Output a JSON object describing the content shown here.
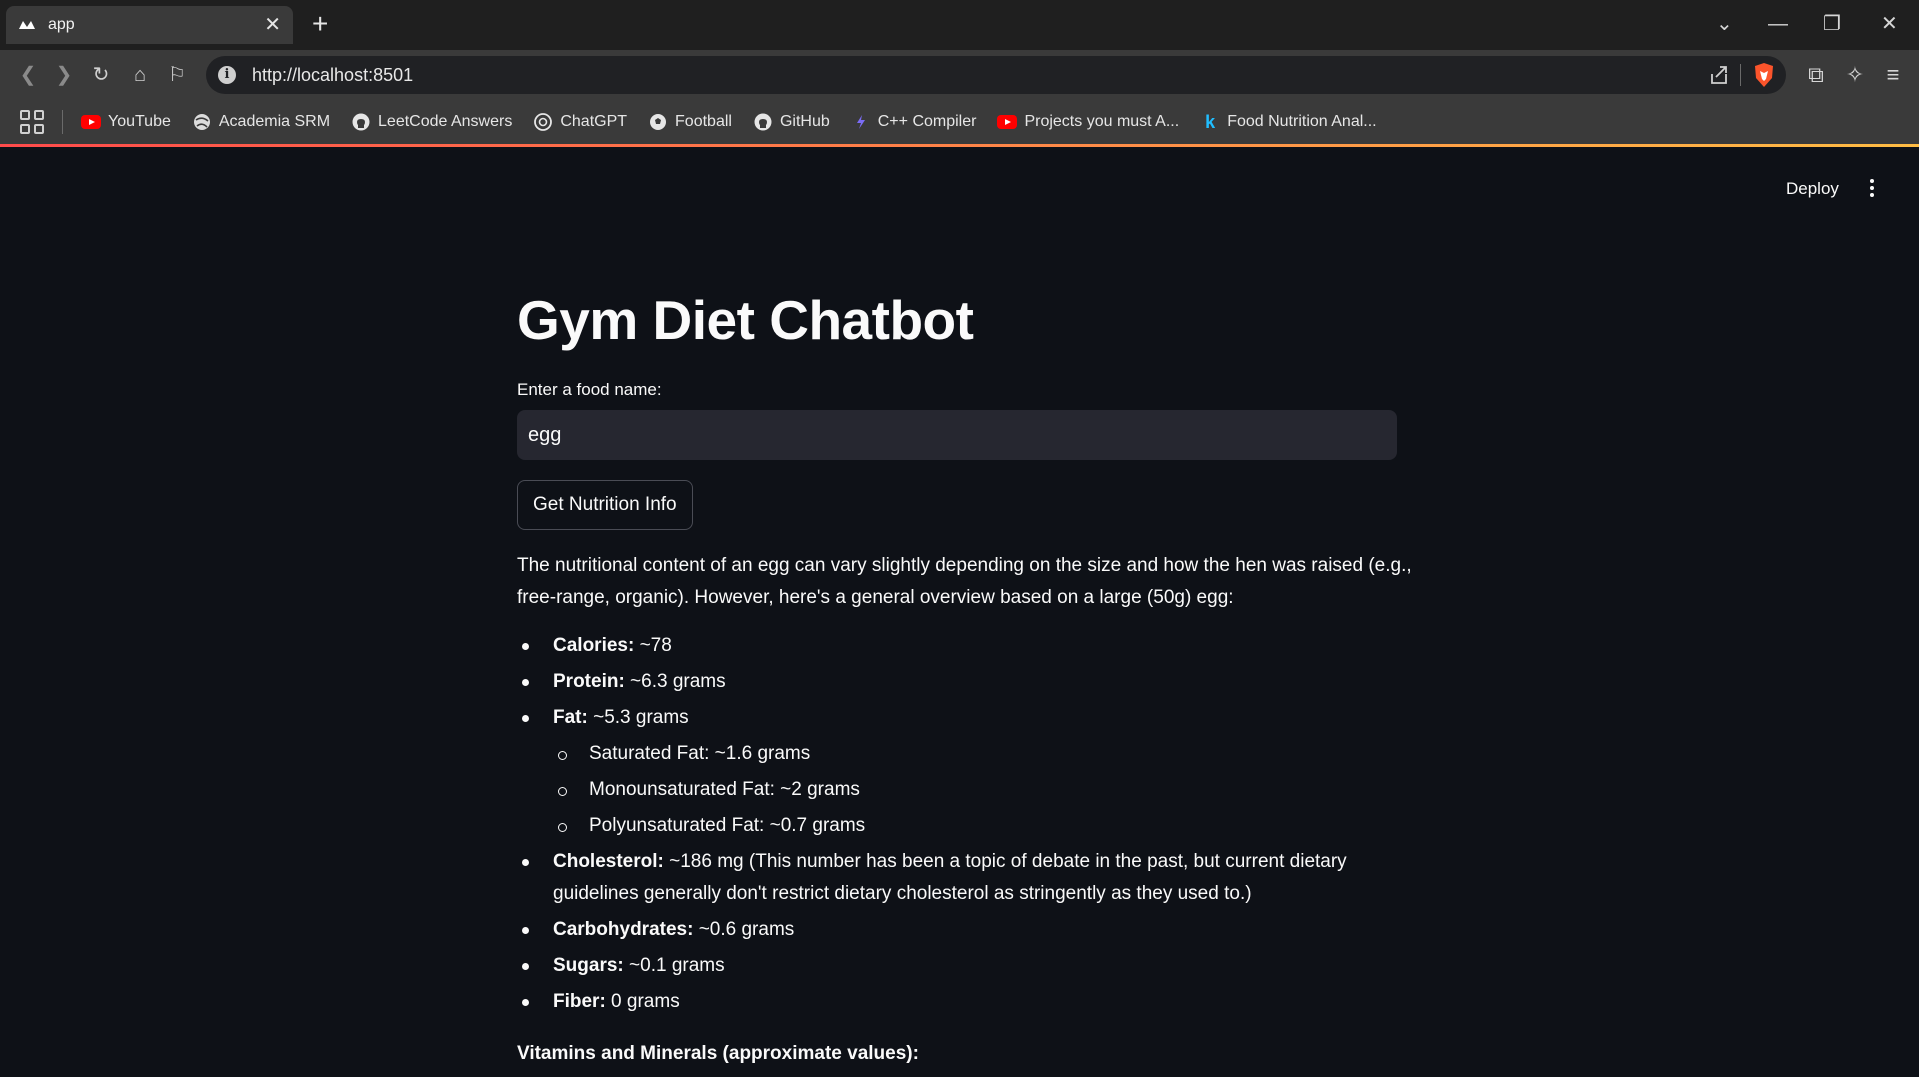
{
  "browser": {
    "tab_title": "app",
    "url": "http://localhost:8501",
    "bookmarks": [
      {
        "label": "YouTube",
        "icon": "youtube-icon"
      },
      {
        "label": "Academia SRM",
        "icon": "globe-icon"
      },
      {
        "label": "LeetCode Answers",
        "icon": "github-icon"
      },
      {
        "label": "ChatGPT",
        "icon": "openai-icon"
      },
      {
        "label": "Football",
        "icon": "football-icon"
      },
      {
        "label": "GitHub",
        "icon": "github-icon"
      },
      {
        "label": "C++ Compiler",
        "icon": "compiler-icon"
      },
      {
        "label": "Projects you must A...",
        "icon": "youtube-icon"
      },
      {
        "label": "Food Nutrition Anal...",
        "icon": "kaggle-icon"
      }
    ]
  },
  "app": {
    "deploy_label": "Deploy",
    "title": "Gym Diet Chatbot",
    "input_label": "Enter a food name:",
    "input_value": "egg",
    "button_label": "Get Nutrition Info",
    "intro": "The nutritional content of an egg can vary slightly depending on the size and how the hen was raised (e.g., free-range, organic). However, here's a general overview based on a large (50g) egg:",
    "nutrients": [
      {
        "name": "Calories:",
        "value": " ~78",
        "level": 0
      },
      {
        "name": "Protein:",
        "value": " ~6.3 grams",
        "level": 0
      },
      {
        "name": "Fat:",
        "value": " ~5.3 grams",
        "level": 0
      },
      {
        "name": "",
        "value": "Saturated Fat: ~1.6 grams",
        "level": 1
      },
      {
        "name": "",
        "value": "Monounsaturated Fat: ~2 grams",
        "level": 1
      },
      {
        "name": "",
        "value": "Polyunsaturated Fat: ~0.7 grams",
        "level": 1
      },
      {
        "name": "Cholesterol:",
        "value": " ~186 mg (This number has been a topic of debate in the past, but current dietary guidelines generally don't restrict dietary cholesterol as stringently as they used to.)",
        "level": 0
      },
      {
        "name": "Carbohydrates:",
        "value": " ~0.6 grams",
        "level": 0
      },
      {
        "name": "Sugars:",
        "value": " ~0.1 grams",
        "level": 0
      },
      {
        "name": "Fiber:",
        "value": " 0 grams",
        "level": 0
      }
    ],
    "vitamins_heading": "Vitamins and Minerals (approximate values):"
  },
  "colors": {
    "app_background": "#0e1117",
    "input_background": "#262730",
    "accent": "#ff4b4b",
    "text": "#fafafa"
  }
}
